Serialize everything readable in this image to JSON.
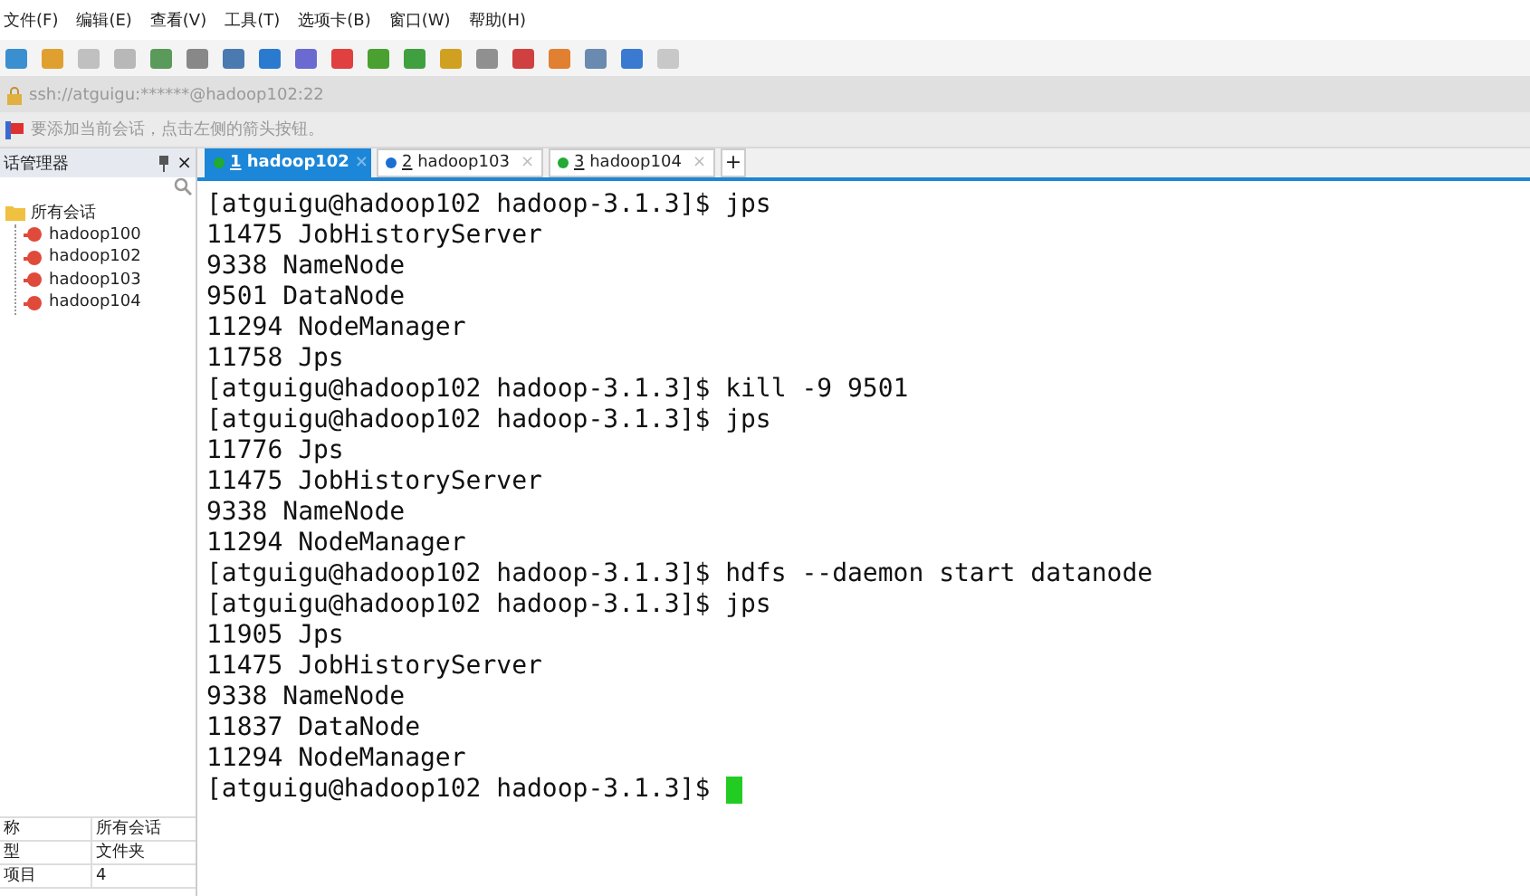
{
  "menu": [
    "文件(F)",
    "编辑(E)",
    "查看(V)",
    "工具(T)",
    "选项卡(B)",
    "窗口(W)",
    "帮助(H)"
  ],
  "address": "ssh://atguigu:******@hadoop102:22",
  "hint": "要添加当前会话，点击左侧的箭头按钮。",
  "sidebar": {
    "title": "话管理器",
    "close": "×",
    "tree": {
      "label": "所有会话",
      "expanded": true,
      "children": [
        {
          "label": "hadoop100"
        },
        {
          "label": "hadoop102"
        },
        {
          "label": "hadoop103"
        },
        {
          "label": "hadoop104"
        }
      ]
    },
    "properties": [
      {
        "name": "称",
        "value": "所有会话"
      },
      {
        "name": "型",
        "value": "文件夹"
      },
      {
        "name": "项目",
        "value": "4"
      }
    ]
  },
  "tabs": [
    {
      "number": "1",
      "label": "hadoop102",
      "selected": true,
      "color": "#22aa33",
      "close": "×"
    },
    {
      "number": "2",
      "label": "hadoop103",
      "selected": false,
      "color": "#1a6fd0",
      "close": "×"
    },
    {
      "number": "3",
      "label": "hadoop104",
      "selected": false,
      "color": "#22aa33",
      "close": "×"
    }
  ],
  "new_tab": "+",
  "terminal": {
    "lines": [
      "[atguigu@hadoop102 hadoop-3.1.3]$ jps",
      "11475 JobHistoryServer",
      "9338 NameNode",
      "9501 DataNode",
      "11294 NodeManager",
      "11758 Jps",
      "[atguigu@hadoop102 hadoop-3.1.3]$ kill -9 9501",
      "[atguigu@hadoop102 hadoop-3.1.3]$ jps",
      "11776 Jps",
      "11475 JobHistoryServer",
      "9338 NameNode",
      "11294 NodeManager",
      "[atguigu@hadoop102 hadoop-3.1.3]$ hdfs --daemon start datanode",
      "[atguigu@hadoop102 hadoop-3.1.3]$ jps",
      "11905 Jps",
      "11475 JobHistoryServer",
      "9338 NameNode",
      "11837 DataNode",
      "11294 NodeManager",
      "[atguigu@hadoop102 hadoop-3.1.3]$ "
    ],
    "cursor": true
  }
}
